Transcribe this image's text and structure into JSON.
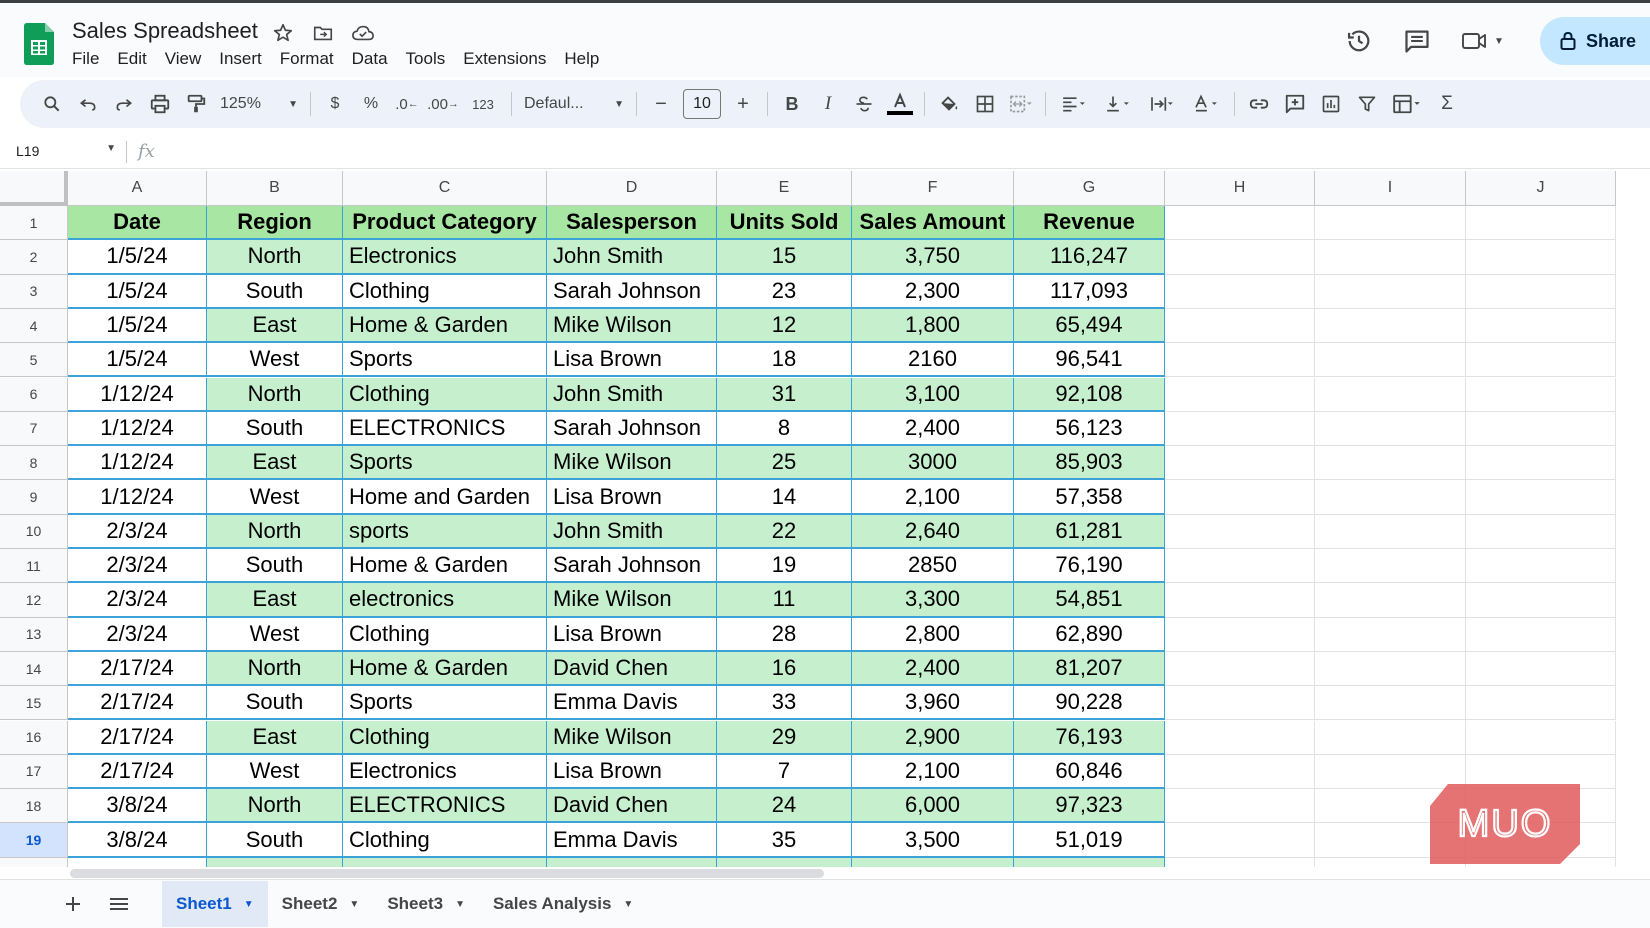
{
  "app": {
    "title": "Sales Spreadsheet",
    "menu": [
      "File",
      "Edit",
      "View",
      "Insert",
      "Format",
      "Data",
      "Tools",
      "Extensions",
      "Help"
    ],
    "share_label": "Share"
  },
  "toolbar": {
    "zoom": "125%",
    "currency": "$",
    "percent": "%",
    "dec_less": ".0",
    "dec_more": ".00",
    "number_format": "123",
    "font": "Defaul...",
    "font_size": "10",
    "minus": "−",
    "plus": "+",
    "bold": "B",
    "italic": "I",
    "sum": "Σ"
  },
  "formula_bar": {
    "cell_ref": "L19",
    "fx": "fx",
    "content": ""
  },
  "grid": {
    "columns": [
      "A",
      "B",
      "C",
      "D",
      "E",
      "F",
      "G",
      "H",
      "I",
      "J"
    ],
    "active_row": 19,
    "header": [
      "Date",
      "Region",
      "Product Category",
      "Salesperson",
      "Units Sold",
      "Sales Amount",
      "Revenue"
    ],
    "rows": [
      [
        "1/5/24",
        "North",
        "Electronics",
        "John Smith",
        "15",
        "3,750",
        "116,247"
      ],
      [
        "1/5/24",
        "South",
        "Clothing",
        "Sarah Johnson",
        "23",
        "2,300",
        "117,093"
      ],
      [
        "1/5/24",
        "East",
        "Home & Garden",
        "Mike Wilson",
        "12",
        "1,800",
        "65,494"
      ],
      [
        "1/5/24",
        "West",
        "Sports",
        "Lisa Brown",
        "18",
        "2160",
        "96,541"
      ],
      [
        "1/12/24",
        "North",
        "Clothing",
        "John Smith",
        "31",
        "3,100",
        "92,108"
      ],
      [
        "1/12/24",
        "South",
        "ELECTRONICS",
        "Sarah Johnson",
        "8",
        "2,400",
        "56,123"
      ],
      [
        "1/12/24",
        "East",
        "Sports",
        "Mike Wilson",
        "25",
        "3000",
        "85,903"
      ],
      [
        "1/12/24",
        "West",
        "Home and Garden",
        "Lisa Brown",
        "14",
        "2,100",
        "57,358"
      ],
      [
        "2/3/24",
        "North",
        "sports",
        "John Smith",
        "22",
        "2,640",
        "61,281"
      ],
      [
        "2/3/24",
        "South",
        "Home & Garden",
        "Sarah Johnson",
        "19",
        "2850",
        "76,190"
      ],
      [
        "2/3/24",
        "East",
        "electronics",
        "Mike Wilson",
        "11",
        "3,300",
        "54,851"
      ],
      [
        "2/3/24",
        "West",
        "Clothing",
        "Lisa Brown",
        "28",
        "2,800",
        "62,890"
      ],
      [
        "2/17/24",
        "North",
        "Home & Garden",
        "David Chen",
        "16",
        "2,400",
        "81,207"
      ],
      [
        "2/17/24",
        "South",
        "Sports",
        "Emma Davis",
        "33",
        "3,960",
        "90,228"
      ],
      [
        "2/17/24",
        "East",
        "Clothing",
        "Mike Wilson",
        "29",
        "2,900",
        "76,193"
      ],
      [
        "2/17/24",
        "West",
        "Electronics",
        "Lisa Brown",
        "7",
        "2,100",
        "60,846"
      ],
      [
        "3/8/24",
        "North",
        "ELECTRONICS",
        "David Chen",
        "24",
        "6,000",
        "97,323"
      ],
      [
        "3/8/24",
        "South",
        "Clothing",
        "Emma Davis",
        "35",
        "3,500",
        "51,019"
      ]
    ]
  },
  "sheets": {
    "tabs": [
      "Sheet1",
      "Sheet2",
      "Sheet3",
      "Sales Analysis"
    ],
    "active": "Sheet1"
  },
  "watermark": "MUO",
  "colors": {
    "header_fill": "#a8e6a3",
    "band_fill": "#c6efce",
    "border_accent": "#3ba3d8",
    "active_tab": "#0b57d0",
    "share_bg": "#c2e7ff"
  }
}
